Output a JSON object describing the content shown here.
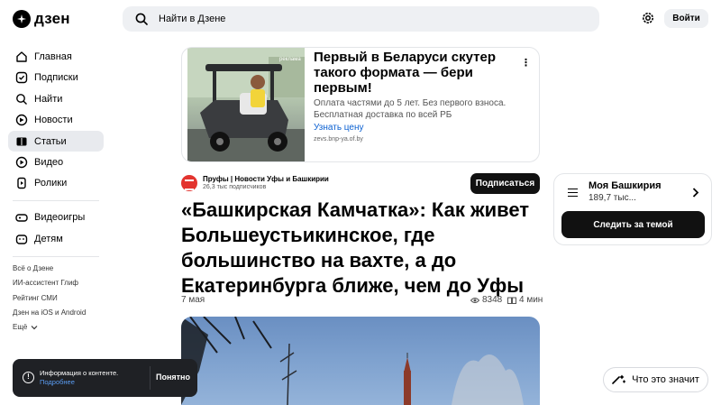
{
  "header": {
    "logo_text": "дзен",
    "search_placeholder": "Найти в Дзене",
    "login_label": "Войти"
  },
  "sidebar": {
    "items": [
      {
        "label": "Главная",
        "icon": "home-icon",
        "active": false
      },
      {
        "label": "Подписки",
        "icon": "subscriptions-icon",
        "active": false
      },
      {
        "label": "Найти",
        "icon": "search-icon",
        "active": false
      },
      {
        "label": "Новости",
        "icon": "news-icon",
        "active": false
      },
      {
        "label": "Статьи",
        "icon": "articles-icon",
        "active": true
      },
      {
        "label": "Видео",
        "icon": "video-icon",
        "active": false
      },
      {
        "label": "Ролики",
        "icon": "shorts-icon",
        "active": false
      },
      {
        "label": "Видеоигры",
        "icon": "gamepad-icon",
        "active": false
      },
      {
        "label": "Детям",
        "icon": "kids-icon",
        "active": false
      }
    ],
    "footer_links": [
      "Всё о Дзене",
      "ИИ-ассистент Глиф",
      "Рейтинг СМИ",
      "Дзен на iOS и Android"
    ],
    "more_label": "Ещё"
  },
  "ad": {
    "title": "Первый в Беларуси скутер такого формата — бери первым!",
    "description": "Оплата частями до 5 лет. Без первого взноса. Бесплатная доставка по всей РБ",
    "cta": "Узнать цену",
    "domain": "zevs.bnp-ya.of.by",
    "image_label": "реклама"
  },
  "channel": {
    "name": "Пруфы | Новости Уфы и Башкирии",
    "subscribers": "26,3 тыс подписчиков",
    "subscribe_label": "Подписаться"
  },
  "article": {
    "title": "«Башкирская Камчатка»: Как живет Большеустьикинское, где большинство на вахте, а до Екатеринбурга ближе, чем до Уфы",
    "date": "7 мая",
    "views": "8348",
    "read_time": "4 мин"
  },
  "topic_card": {
    "name": "Моя Башкирия",
    "count": "189,7 тыс...",
    "follow_label": "Следить за темой"
  },
  "cookie_toast": {
    "text": "Информация о контенте.",
    "link": "Подробнее",
    "accept_label": "Понятно"
  },
  "meaning_button": {
    "label": "Что это значит"
  }
}
